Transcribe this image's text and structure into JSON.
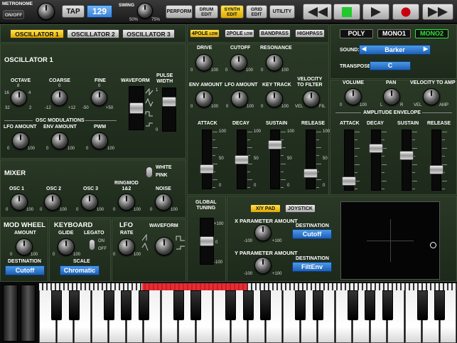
{
  "top_bar": {
    "metronome_label": "METRONOME",
    "onoff_label": "ON/OFF",
    "tap_label": "TAP",
    "tempo_value": "129",
    "swing_label": "SWING",
    "swing_min": "50%",
    "swing_max": "75%",
    "nav": [
      {
        "label": "PERFORM"
      },
      {
        "label": "DRUM\nEDIT"
      },
      {
        "label": "SYNTH\nEDIT"
      },
      {
        "label": "GRID\nEDIT"
      },
      {
        "label": "UTILITY"
      }
    ],
    "transport_icons": [
      "rewind-icon",
      "play-icon",
      "play-forward-icon",
      "record-icon",
      "fast-forward-icon"
    ],
    "active_color": "#ffd21a",
    "play_color": "#22c82c",
    "record_color": "#c80010"
  },
  "osc_tabs": [
    "OSCILLATOR 1",
    "OSCILLATOR 2",
    "OSCILLATOR 3"
  ],
  "osc1": {
    "title": "OSCILLATOR 1",
    "octave": {
      "label": "OCTAVE",
      "values": [
        "8",
        "16",
        "4",
        "32",
        "2"
      ]
    },
    "coarse": {
      "label": "COARSE",
      "mid": "0",
      "min": "-12",
      "max": "+12"
    },
    "fine": {
      "label": "FINE",
      "mid": "0",
      "min": "-50",
      "max": "+50"
    },
    "waveform_label": "WAVEFORM",
    "pulse_width": {
      "label": "PULSE\nWIDTH",
      "max": "1",
      "min": "0"
    },
    "osc_mod_label": "OSC MODULATIONS",
    "lfo_amount": {
      "label": "LFO AMOUNT",
      "min": "0",
      "max": "100"
    },
    "env_amount": {
      "label": "ENV AMOUNT",
      "min": "0",
      "max": "100"
    },
    "pwm": {
      "label": "PWM",
      "min": "0",
      "max": "100"
    }
  },
  "mixer": {
    "title": "MIXER",
    "white_label": "WHITE",
    "pink_label": "PINK",
    "channels": [
      {
        "label": "OSC 1",
        "min": "0",
        "max": "100"
      },
      {
        "label": "OSC 2",
        "min": "0",
        "max": "100"
      },
      {
        "label": "OSC 3",
        "min": "0",
        "max": "100"
      },
      {
        "label": "RINGMOD\n1&2",
        "min": "0",
        "max": "100"
      },
      {
        "label": "NOISE",
        "min": "0",
        "max": "100"
      }
    ]
  },
  "mod_wheel": {
    "title": "MOD WHEEL",
    "amount_label": "AMOUNT",
    "min": "0",
    "max": "100",
    "destination_label": "DESTINATION",
    "destination_value": "Cutoff"
  },
  "keyboard_section": {
    "title": "KEYBOARD",
    "glide_label": "GLIDE",
    "legato_label": "LEGATO",
    "min": "0",
    "max": "100",
    "on_label": "ON",
    "off_label": "OFF",
    "scale_label": "SCALE",
    "scale_value": "Chromatic"
  },
  "lfo": {
    "title": "LFO",
    "rate_label": "RATE",
    "waveform_label": "WAVEFORM",
    "min": "0",
    "max": "100"
  },
  "filter": {
    "types": [
      "4POLE",
      "2POLE",
      "BANDPASS",
      "HIGHPASS"
    ],
    "low_tag": "LOW",
    "drive": {
      "label": "DRIVE",
      "min": "0",
      "max": "100"
    },
    "cutoff": {
      "label": "CUTOFF",
      "min": "0",
      "max": "100"
    },
    "resonance": {
      "label": "RESONANCE",
      "min": "0",
      "max": "100"
    },
    "env_amount": {
      "label": "ENV AMOUNT",
      "min": "0",
      "max": "100"
    },
    "lfo_amount": {
      "label": "LFO AMOUNT",
      "min": "0",
      "max": "100"
    },
    "key_track": {
      "label": "KEY TRACK",
      "min": "0",
      "max": "100"
    },
    "velocity": {
      "label": "VELOCITY\nTO FILTER",
      "min": "VEL",
      "max": "FIL"
    },
    "env": [
      {
        "label": "ATTACK"
      },
      {
        "label": "DECAY"
      },
      {
        "label": "SUSTAIN"
      },
      {
        "label": "RELEASE"
      }
    ],
    "scale": [
      "100",
      "50",
      "0"
    ],
    "slider_levels": [
      0.3,
      0.48,
      0.78,
      0.22
    ]
  },
  "voice": {
    "modes": [
      "POLY",
      "MONO1",
      "MONO2"
    ],
    "sound_label": "SOUND:",
    "sound_value": "Barker",
    "transpose_label": "TRANSPOSE:",
    "transpose_value": "C"
  },
  "amp": {
    "volume": {
      "label": "VOLUME",
      "min": "0",
      "max": "100"
    },
    "pan": {
      "label": "PAN",
      "min": "L",
      "max": "R"
    },
    "velocity": {
      "label": "VELOCITY TO AMP",
      "min": "VEL",
      "max": "AMP"
    },
    "env_label": "AMPLITUDE ENVELOPE",
    "env": [
      {
        "label": "ATTACK"
      },
      {
        "label": "DECAY"
      },
      {
        "label": "SUSTAIN"
      },
      {
        "label": "RELEASE"
      }
    ],
    "slider_levels": [
      0.08,
      0.72,
      0.58,
      0.3
    ]
  },
  "global_tuning": {
    "label": "GLOBAL\nTUNING",
    "max": "+100",
    "mid": "0",
    "min": "-100"
  },
  "xy": {
    "modes": [
      "X/Y PAD",
      "JOYSTICK"
    ],
    "x_label": "X PARAMETER AMOUNT",
    "y_label": "Y PARAMETER AMOUNT",
    "min": "-100",
    "max": "+100",
    "destination_label": "DESTINATION",
    "x_destination": "Cutoff",
    "y_destination": "FiltEnv"
  }
}
